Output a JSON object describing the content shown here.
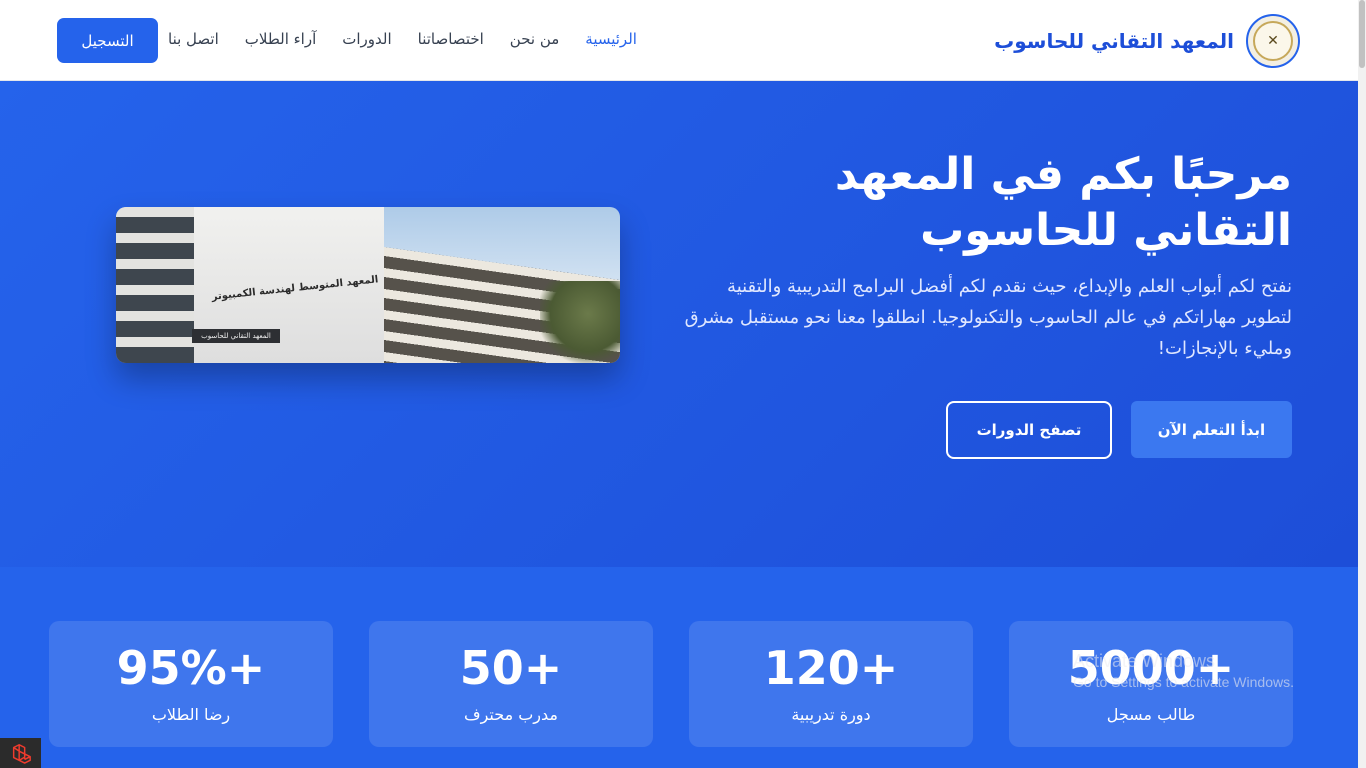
{
  "header": {
    "brand_name": "المعهد التقاني للحاسوب",
    "logo_icon": "institute-seal-icon",
    "nav": [
      {
        "label": "الرئيسية",
        "active": true
      },
      {
        "label": "من نحن",
        "active": false
      },
      {
        "label": "اختصاصاتنا",
        "active": false
      },
      {
        "label": "الدورات",
        "active": false
      },
      {
        "label": "آراء الطلاب",
        "active": false
      },
      {
        "label": "اتصل بنا",
        "active": false
      }
    ],
    "register_label": "التسجيل"
  },
  "hero": {
    "title": "مرحبًا بكم في المعهد التقاني للحاسوب",
    "description": "نفتح لكم أبواب العلم والإبداع، حيث نقدم لكم أفضل البرامج التدريبية والتقنية لتطوير مهاراتكم في عالم الحاسوب والتكنولوجيا. انطلقوا معنا نحو مستقبل مشرق ومليء بالإنجازات!",
    "primary_button": "ابدأ التعلم الآن",
    "secondary_button": "تصفح الدورات",
    "image": {
      "sign_main": "المعهد المتوسط لهندسة الكمبيوتر",
      "sign_small": "المعهد التقاني للحاسوب"
    }
  },
  "stats": [
    {
      "value": "5000+",
      "label": "طالب مسجل"
    },
    {
      "value": "120+",
      "label": "دورة تدريبية"
    },
    {
      "value": "50+",
      "label": "مدرب محترف"
    },
    {
      "value": "95%+",
      "label": "رضا الطلاب"
    }
  ],
  "watermark": {
    "title": "Activate Windows",
    "subtitle": "Go to Settings to activate Windows."
  },
  "colors": {
    "primary": "#2563eb",
    "primary_dark": "#1d4ed8",
    "white": "#ffffff"
  }
}
